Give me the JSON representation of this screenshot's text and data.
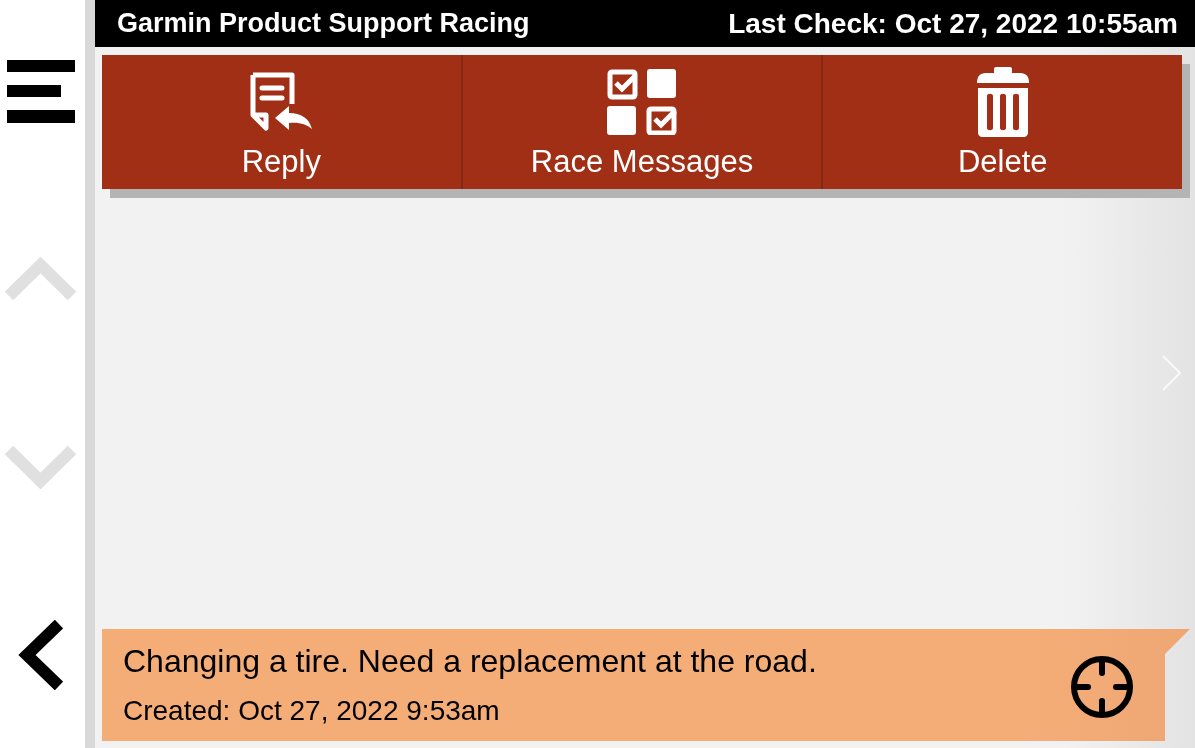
{
  "header": {
    "title": "Garmin Product Support Racing",
    "last_check": "Last Check: Oct 27, 2022 10:55am"
  },
  "sidebar": {
    "buttons": [
      {
        "kind": "menu",
        "disabled": false
      },
      {
        "kind": "up",
        "disabled": true
      },
      {
        "kind": "down",
        "disabled": true
      },
      {
        "kind": "back",
        "disabled": false
      }
    ]
  },
  "toolbar": [
    {
      "kind": "reply",
      "label": "Reply"
    },
    {
      "kind": "race_messages",
      "label": "Race Messages"
    },
    {
      "kind": "delete",
      "label": "Delete"
    }
  ],
  "next_page": {
    "disabled": true
  },
  "messages": [
    {
      "text": "Changing a tire. Need a replacement at the road.",
      "created": "Created: Oct 27, 2022 9:53am"
    }
  ]
}
